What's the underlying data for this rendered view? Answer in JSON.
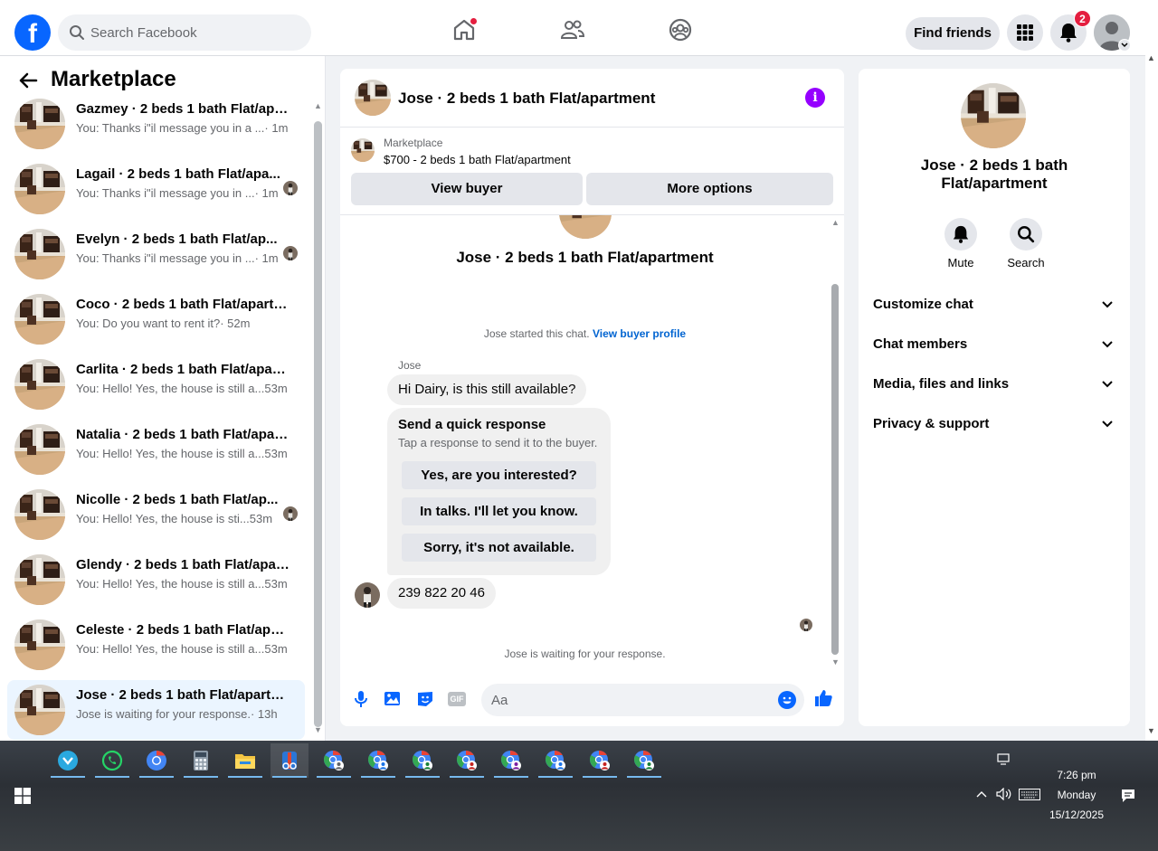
{
  "topnav": {
    "logo_letter": "f",
    "search_placeholder": "Search Facebook",
    "find_friends_label": "Find friends",
    "notifications_count": "2"
  },
  "marketplace": {
    "title": "Marketplace",
    "conversations": [
      {
        "title": "Gazmey · 2 beds 1 bath Flat/apa...",
        "preview": "You: Thanks i\"il message you in a ...",
        "time": " · 1m",
        "seen_avatar": false,
        "active": false
      },
      {
        "title": "Lagail · 2 beds 1 bath Flat/apa...",
        "preview": "You: Thanks i\"il message you in ...",
        "time": " · 1m",
        "seen_avatar": true,
        "active": false
      },
      {
        "title": "Evelyn · 2 beds 1 bath Flat/ap...",
        "preview": "You: Thanks i\"il message you in ...",
        "time": " · 1m",
        "seen_avatar": true,
        "active": false
      },
      {
        "title": "Coco · 2 beds 1 bath Flat/apartm...",
        "preview": "You: Do you want to rent it?",
        "time": " · 52m",
        "seen_avatar": false,
        "active": false
      },
      {
        "title": "Carlita · 2 beds 1 bath Flat/apart...",
        "preview": "You: Hello! Yes, the house is still a...",
        "time": " 53m",
        "seen_avatar": false,
        "active": false
      },
      {
        "title": "Natalia · 2 beds 1 bath Flat/apar...",
        "preview": "You: Hello! Yes, the house is still a...",
        "time": " 53m",
        "seen_avatar": false,
        "active": false
      },
      {
        "title": "Nicolle · 2 beds 1 bath Flat/ap...",
        "preview": "You: Hello! Yes, the house is sti...",
        "time": " 53m",
        "seen_avatar": true,
        "active": false
      },
      {
        "title": "Glendy · 2 beds 1 bath Flat/apart...",
        "preview": "You: Hello! Yes, the house is still a...",
        "time": " 53m",
        "seen_avatar": false,
        "active": false
      },
      {
        "title": "Celeste · 2 beds 1 bath Flat/apar...",
        "preview": "You: Hello! Yes, the house is still a...",
        "time": " 53m",
        "seen_avatar": false,
        "active": false
      },
      {
        "title": "Jose · 2 beds 1 bath Flat/apartm...",
        "preview": "Jose is waiting for your response.",
        "time": " · 13h",
        "seen_avatar": false,
        "active": true
      }
    ]
  },
  "chat": {
    "header_title": "Jose · 2 beds 1 bath Flat/apartment",
    "listing_source": "Marketplace",
    "listing_price_title": "$700 - 2 beds 1 bath Flat/apartment",
    "view_buyer_label": "View buyer",
    "more_options_label": "More options",
    "thread_title": "Jose · 2 beds 1 bath Flat/apartment",
    "started_text": "Jose started this chat.",
    "view_profile_link": "View buyer profile",
    "sender_name": "Jose",
    "first_message": "Hi Dairy, is this still available?",
    "quick_title": "Send a quick response",
    "quick_subtitle": "Tap a response to send it to the buyer.",
    "quick_replies": [
      "Yes, are you interested?",
      "In talks. I'll let you know.",
      "Sorry, it's not available."
    ],
    "second_message": "239 822 20 46",
    "waiting_text": "Jose is waiting for your response.",
    "composer_placeholder": "Aa",
    "gif_label": "GIF"
  },
  "details": {
    "title": "Jose · 2 beds 1 bath Flat/apartment",
    "mute_label": "Mute",
    "search_label": "Search",
    "sections": [
      "Customize chat",
      "Chat members",
      "Media, files and links",
      "Privacy & support"
    ]
  },
  "taskbar": {
    "apps": [
      "copilot-icon",
      "whatsapp-icon",
      "chrome-icon",
      "calculator-icon",
      "file-explorer-icon",
      "snipping-tool-icon",
      "chrome-profile-icon",
      "chrome-profile-icon",
      "chrome-profile-icon",
      "chrome-profile-icon",
      "chrome-profile-icon",
      "chrome-profile-icon",
      "chrome-profile-icon",
      "chrome-profile-icon"
    ],
    "time": "7:26 pm",
    "day": "Monday",
    "date": "15/12/2025"
  },
  "colors": {
    "brand": "#0866ff",
    "accent_purple": "#9500ff",
    "link_blue": "#0064d1",
    "badge_red": "#e41e3f"
  }
}
